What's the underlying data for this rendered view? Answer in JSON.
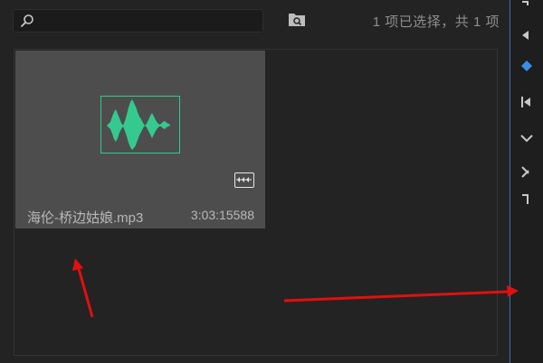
{
  "search": {
    "value": "",
    "placeholder": ""
  },
  "header": {
    "selection_status": "1 项已选择，共 1 项"
  },
  "bin": {
    "items": [
      {
        "name": "海伦-桥边姑娘.mp3",
        "duration": "3:03:15588"
      }
    ]
  },
  "colors": {
    "waveform": "#35c98f",
    "panel_bg": "#232323",
    "card_bg": "#4d4d4d",
    "annotation_arrow": "#e01010",
    "accent_blue": "#3a8ee6"
  },
  "icons": {
    "search": "search-icon",
    "folder_search": "folder-search-icon",
    "audio_badge": "audio-clip-icon"
  }
}
